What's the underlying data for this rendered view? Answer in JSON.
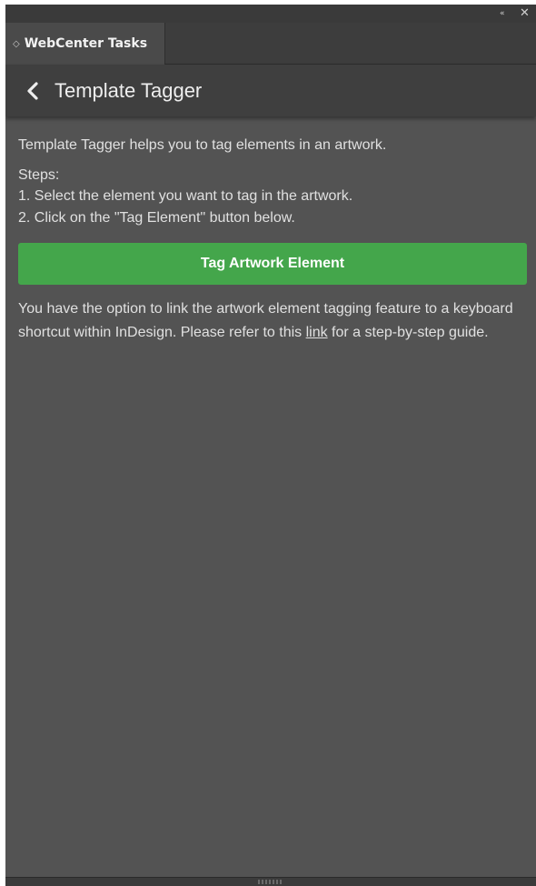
{
  "window": {
    "collapse_glyph": "«",
    "close_glyph": "✕"
  },
  "tab": {
    "grip_glyph": "◇",
    "label": "WebCenter Tasks"
  },
  "header": {
    "back_icon": "chevron-left-icon",
    "title": "Template Tagger"
  },
  "content": {
    "intro": "Template Tagger helps you to tag elements in an artwork.",
    "steps_heading": "Steps:",
    "steps": [
      "1. Select the element you want to tag in the artwork.",
      "2. Click on the \"Tag Element\" button below."
    ],
    "button_label": "Tag Artwork Element",
    "note_before_link": "You have the option to link the artwork element tagging feature to a keyboard shortcut within InDesign. Please refer to this ",
    "note_link": "link",
    "note_after_link": " for a step-by-step guide."
  },
  "colors": {
    "panel_bg": "#535353",
    "header_bg": "#3f3f3f",
    "button_bg": "#44a64b",
    "text": "#e0e0e0"
  }
}
